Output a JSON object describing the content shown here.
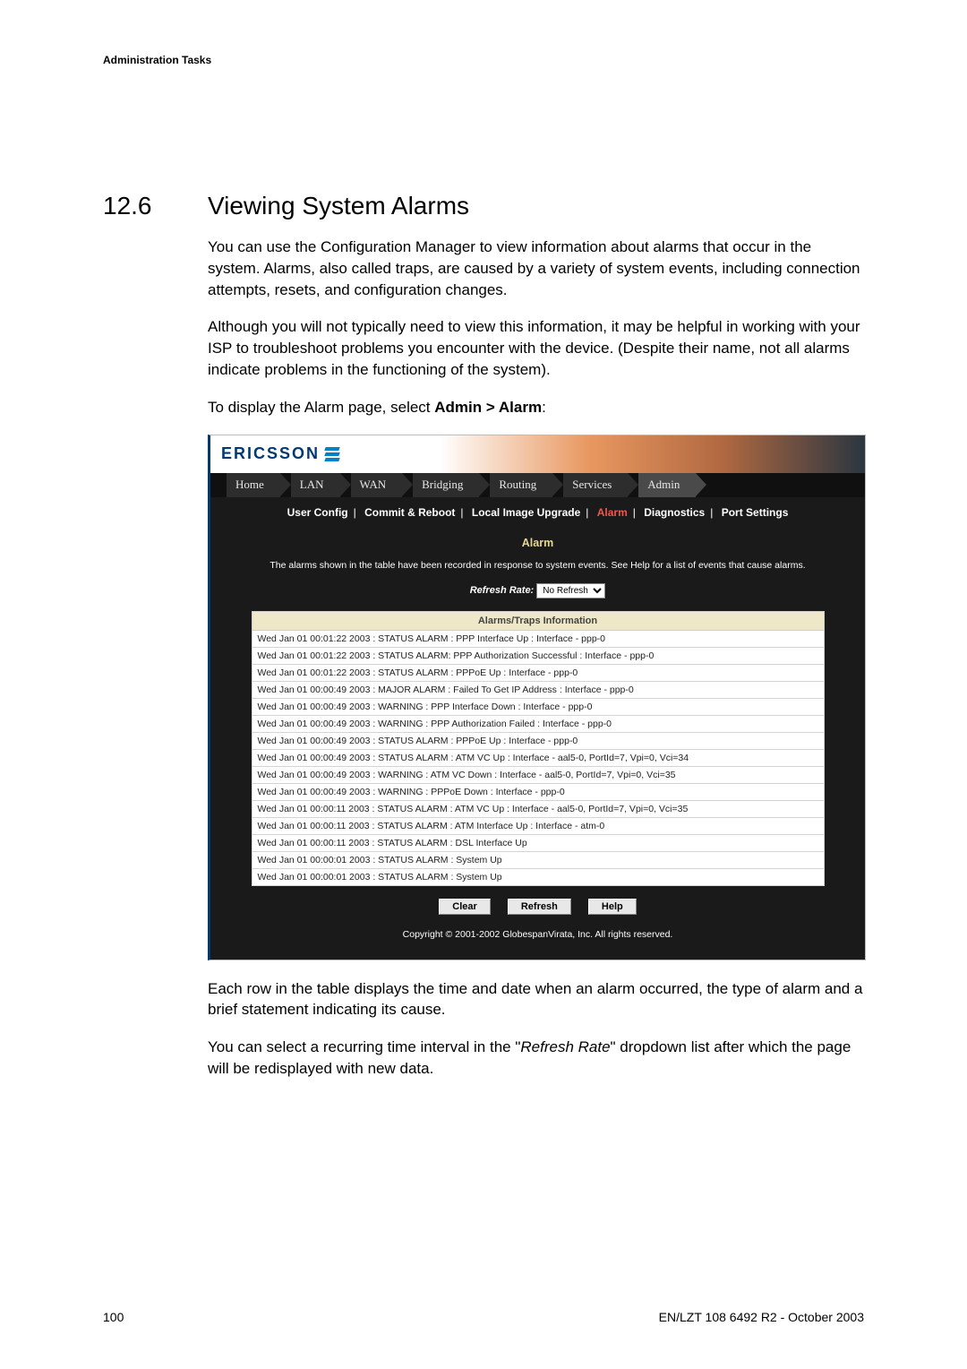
{
  "doc": {
    "header_label": "Administration Tasks",
    "section_number": "12.6",
    "section_title": "Viewing System Alarms",
    "para1": "You can use the Configuration Manager to view information about alarms that occur in the system. Alarms, also called traps, are caused by a variety of system events, including connection attempts, resets, and configuration changes.",
    "para2": "Although you will not typically need to view this information, it may be helpful in working with your ISP to troubleshoot problems you encounter with the device. (Despite their name, not all alarms indicate problems in the functioning of the system).",
    "para3_prefix": "To display the Alarm page, select ",
    "para3_bold": "Admin > Alarm",
    "para3_suffix": ":",
    "para4": "Each row in the table displays the time and date when an alarm occurred, the type of alarm and a brief statement indicating its cause.",
    "para5_a": "You can select a recurring time interval in the \"",
    "para5_i": "Refresh Rate",
    "para5_b": "\" dropdown list after which the page will be redisplayed with new data.",
    "page_number": "100",
    "footer_right": "EN/LZT 108 6492 R2  - October 2003"
  },
  "ui": {
    "logo": "ERICSSON",
    "tabs": [
      "Home",
      "LAN",
      "WAN",
      "Bridging",
      "Routing",
      "Services",
      "Admin"
    ],
    "active_tab_index": 6,
    "subnav": {
      "items": [
        "User Config",
        "Commit & Reboot",
        "Local Image Upgrade",
        "Alarm",
        "Diagnostics",
        "Port Settings"
      ],
      "active_index": 3
    },
    "panel_title": "Alarm",
    "panel_desc": "The alarms shown in the table have been recorded in response to system events. See Help for a list of events that cause alarms.",
    "refresh_label": "Refresh Rate:",
    "refresh_value": "No Refresh",
    "table_header": "Alarms/Traps Information",
    "rows": [
      "Wed Jan 01 00:01:22 2003 : STATUS ALARM : PPP Interface Up : Interface - ppp-0",
      "Wed Jan 01 00:01:22 2003 : STATUS ALARM: PPP Authorization Successful : Interface - ppp-0",
      "Wed Jan 01 00:01:22 2003 : STATUS ALARM : PPPoE Up : Interface - ppp-0",
      "Wed Jan 01 00:00:49 2003 : MAJOR ALARM : Failed To Get IP Address : Interface - ppp-0",
      "Wed Jan 01 00:00:49 2003 : WARNING : PPP Interface Down : Interface - ppp-0",
      "Wed Jan 01 00:00:49 2003 : WARNING : PPP Authorization Failed : Interface - ppp-0",
      "Wed Jan 01 00:00:49 2003 : STATUS ALARM : PPPoE Up : Interface - ppp-0",
      "Wed Jan 01 00:00:49 2003 : STATUS ALARM : ATM VC Up : Interface - aal5-0, PortId=7, Vpi=0, Vci=34",
      "Wed Jan 01 00:00:49 2003 : WARNING : ATM VC Down : Interface - aal5-0, PortId=7, Vpi=0, Vci=35",
      "Wed Jan 01 00:00:49 2003 : WARNING : PPPoE Down : Interface - ppp-0",
      "Wed Jan 01 00:00:11 2003 : STATUS ALARM : ATM VC Up : Interface - aal5-0, PortId=7, Vpi=0, Vci=35",
      "Wed Jan 01 00:00:11 2003 : STATUS ALARM : ATM Interface Up : Interface - atm-0",
      "Wed Jan 01 00:00:11 2003 : STATUS ALARM : DSL Interface Up",
      "Wed Jan 01 00:00:01 2003 : STATUS ALARM : System Up",
      "Wed Jan 01 00:00:01 2003 : STATUS ALARM : System Up"
    ],
    "buttons": {
      "clear": "Clear",
      "refresh": "Refresh",
      "help": "Help"
    },
    "copyright": "Copyright © 2001-2002 GlobespanVirata, Inc. All rights reserved."
  }
}
